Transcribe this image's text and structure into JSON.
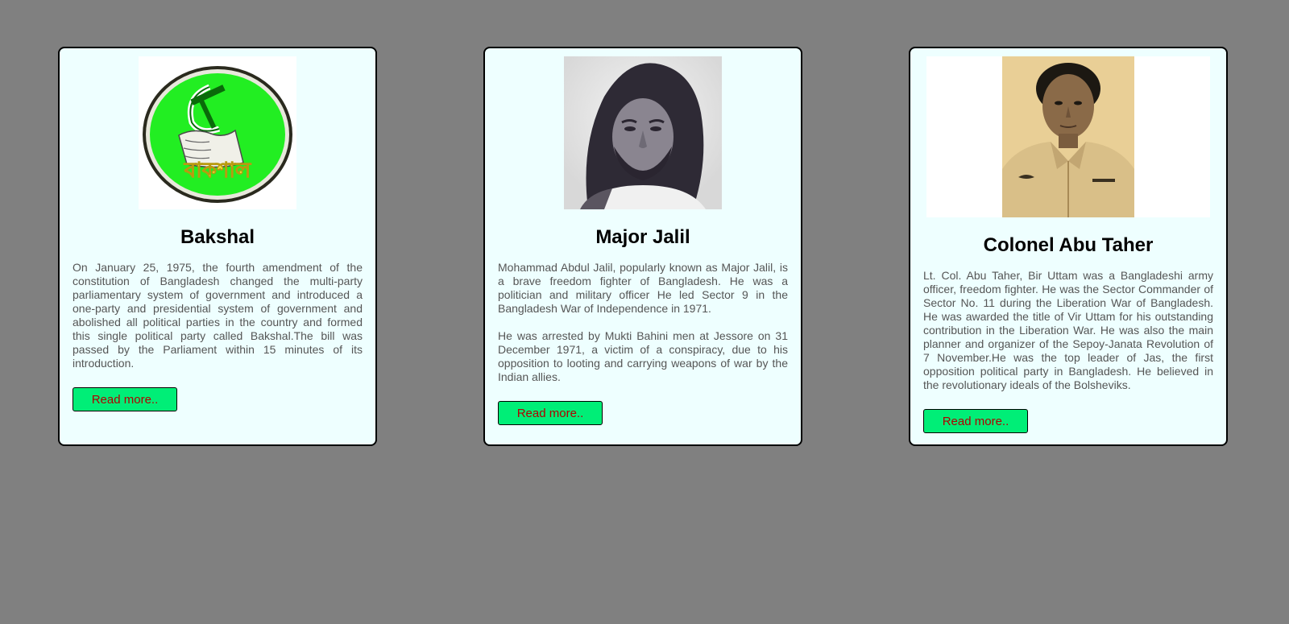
{
  "cards": [
    {
      "title": "Bakshal",
      "image": "bakshal-party-logo",
      "paragraphs": [
        "On January 25, 1975, the fourth amendment of the constitution of Bangladesh changed the multi-party parliamentary system of government and introduced a one-party and presidential system of government and abolished all political parties in the country and formed this single political party called Bakshal.The bill was passed by the Parliament within 15 minutes of its introduction."
      ],
      "button_label": "Read more..",
      "logo_text": "বাকশাল"
    },
    {
      "title": "Major Jalil",
      "image": "major-jalil-portrait",
      "paragraphs": [
        "Mohammad Abdul Jalil, popularly known as Major Jalil, is a brave freedom fighter of Bangladesh. He was a politician and military officer He led Sector 9 in the Bangladesh War of Independence in 1971.",
        "He was arrested by Mukti Bahini men at Jessore on 31 December 1971, a victim of a conspiracy, due to his opposition to looting and carrying weapons of war by the Indian allies."
      ],
      "button_label": "Read more.."
    },
    {
      "title": "Colonel Abu Taher",
      "image": "colonel-abu-taher-portrait",
      "paragraphs": [
        "Lt. Col. Abu Taher, Bir Uttam was a Bangladeshi army officer, freedom fighter. He was the Sector Commander of Sector No. 11 during the Liberation War of Bangladesh. He was awarded the title of Vir Uttam for his outstanding contribution in the Liberation War. He was also the main planner and organizer of the Sepoy-Janata Revolution of 7 November.He was the top leader of Jas, the first opposition political party in Bangladesh. He believed in the revolutionary ideals of the Bolsheviks."
      ],
      "button_label": "Read more.."
    }
  ],
  "colors": {
    "page_background": "#808080",
    "card_background": "#eeffff",
    "button_background": "#00ee77",
    "button_text": "#b00000",
    "body_text": "#555555"
  }
}
